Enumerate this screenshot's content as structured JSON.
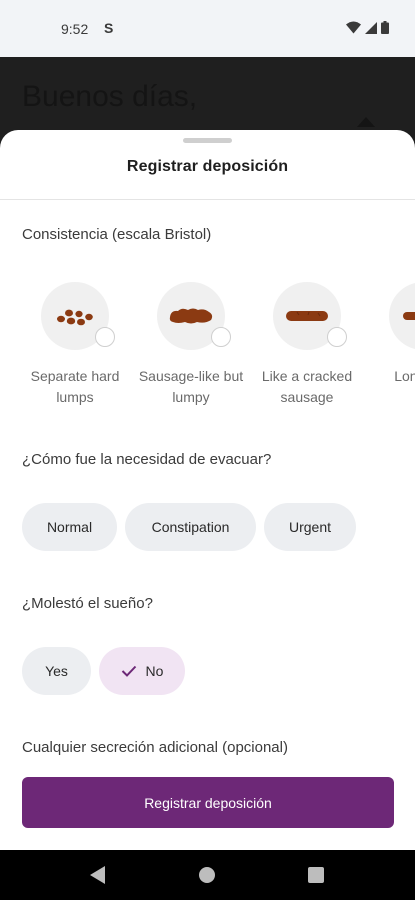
{
  "status_bar": {
    "time": "9:52",
    "notification_glyph": "S"
  },
  "background": {
    "greeting": "Buenos días,"
  },
  "sheet": {
    "title": "Registrar deposición",
    "consistency": {
      "label": "Consistencia (escala Bristol)",
      "items": [
        {
          "label": "Separate hard lumps",
          "icon": "separate-lumps-icon"
        },
        {
          "label": "Sausage-like but lumpy",
          "icon": "lumpy-sausage-icon"
        },
        {
          "label": "Like a cracked sausage",
          "icon": "cracked-sausage-icon"
        },
        {
          "label": "Long, sm",
          "icon": "smooth-sausage-icon"
        }
      ]
    },
    "urgency": {
      "label": "¿Cómo fue la necesidad de evacuar?",
      "options": [
        "Normal",
        "Constipation",
        "Urgent"
      ]
    },
    "sleep": {
      "label": "¿Molestó el sueño?",
      "options": [
        "Yes",
        "No"
      ],
      "selected": "No"
    },
    "secretion": {
      "label": "Cualquier secreción adicional (opcional)"
    },
    "submit_label": "Registrar deposición"
  },
  "colors": {
    "accent": "#6d2877",
    "selected_chip": "#f1e4f3",
    "chip": "#eceef1",
    "stool": "#8b3a12"
  }
}
